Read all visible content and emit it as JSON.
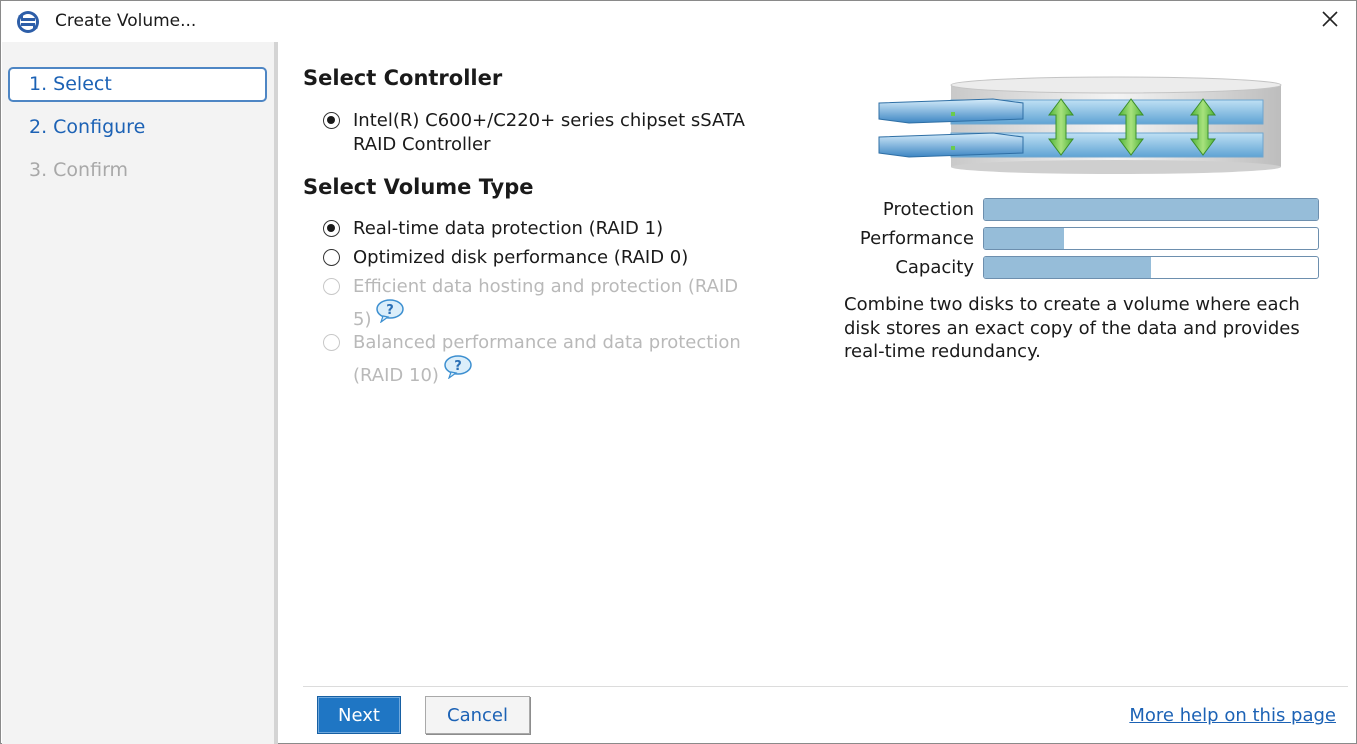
{
  "window": {
    "title": "Create Volume..."
  },
  "icons": {
    "app": "raid-app-icon",
    "close": "close-icon",
    "help": "help-icon"
  },
  "sidebar": {
    "steps": [
      {
        "label": "1. Select",
        "state": "active"
      },
      {
        "label": "2. Configure",
        "state": "link"
      },
      {
        "label": "3. Confirm",
        "state": "disabled"
      }
    ]
  },
  "controller": {
    "heading": "Select Controller",
    "options": [
      {
        "line1": "Intel(R) C600+/C220+ series chipset sSATA",
        "line2": "RAID Controller",
        "selected": true
      }
    ]
  },
  "volume_type": {
    "heading": "Select Volume Type",
    "options": [
      {
        "label": "Real-time data protection (RAID 1)",
        "selected": true,
        "enabled": true
      },
      {
        "label": "Optimized disk performance (RAID 0)",
        "selected": false,
        "enabled": true
      },
      {
        "line1": "Efficient data hosting and protection (RAID",
        "line2": "5)",
        "selected": false,
        "enabled": false,
        "help": true
      },
      {
        "line1": "Balanced performance and data protection",
        "line2": "(RAID 10)",
        "selected": false,
        "enabled": false,
        "help": true
      }
    ]
  },
  "meters": [
    {
      "label": "Protection",
      "fraction": 1.0
    },
    {
      "label": "Performance",
      "fraction": 0.24
    },
    {
      "label": "Capacity",
      "fraction": 0.5
    }
  ],
  "description": "Combine two disks to create a volume where each disk stores an exact copy of the data and provides real-time redundancy.",
  "footer": {
    "next_label": "Next",
    "cancel_label": "Cancel",
    "help_link": "More help on this page"
  },
  "colors": {
    "accent": "#1c62b5",
    "primary_button": "#1f76c4",
    "meter_fill": "#96bdd9",
    "disabled_text": "#b9b9b9"
  }
}
